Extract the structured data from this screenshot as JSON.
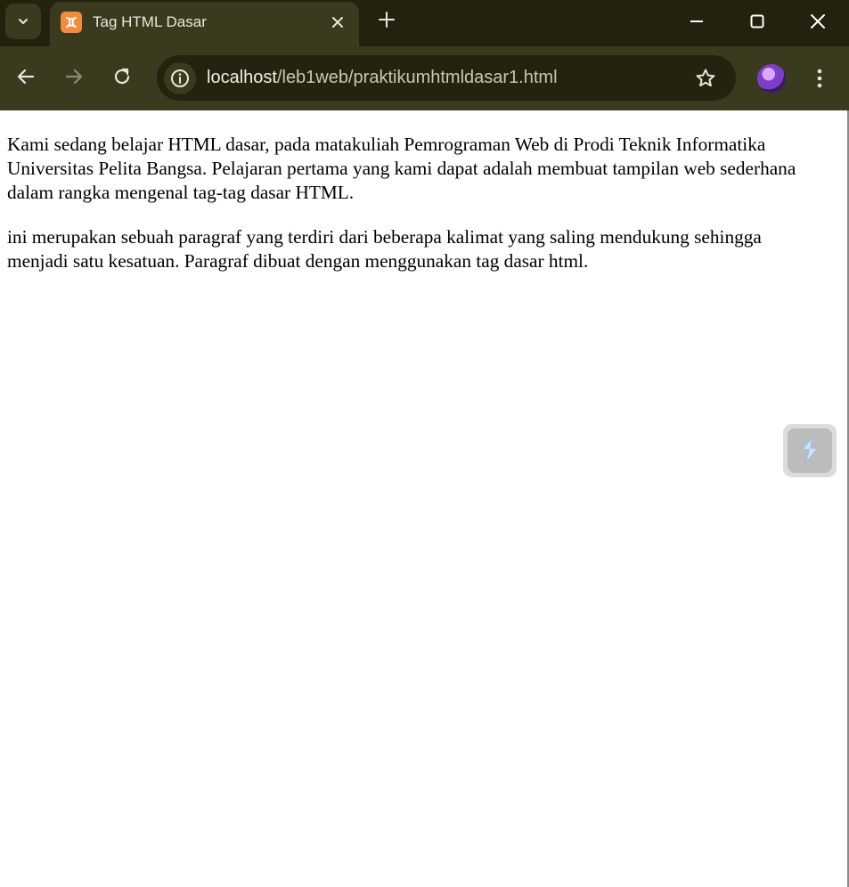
{
  "browser": {
    "tab": {
      "title": "Tag HTML Dasar"
    },
    "address_bar": {
      "url_host": "localhost",
      "url_path": "/leb1web/praktikumhtmldasar1.html"
    }
  },
  "page": {
    "paragraphs": [
      "Kami sedang belajar HTML dasar, pada matakuliah Pemrograman Web di Prodi Teknik Informatika Universitas Pelita Bangsa. Pelajaran pertama yang kami dapat adalah membuat tampilan web sederhana dalam rangka mengenal tag-tag dasar HTML.",
      "ini merupakan sebuah paragraf yang terdiri dari beberapa kalimat yang saling mendukung sehingga menjadi satu kesatuan. Paragraf dibuat dengan menggunakan tag dasar html."
    ]
  },
  "icons": {
    "tab_search": "chevron-down-icon",
    "favicon": "xampp-icon",
    "close": "close-icon",
    "new_tab": "plus-icon",
    "back": "arrow-left-icon",
    "forward": "arrow-right-icon",
    "reload": "reload-icon",
    "site_info": "info-icon",
    "bookmark": "star-icon",
    "menu": "kebab-menu-icon",
    "floating_widget": "lightning-icon"
  },
  "colors": {
    "frame": "#22220f",
    "toolbar": "#3a3a1f",
    "omnibox": "#23230f",
    "favicon": "#f28b3a",
    "page_background": "#ffffff"
  }
}
